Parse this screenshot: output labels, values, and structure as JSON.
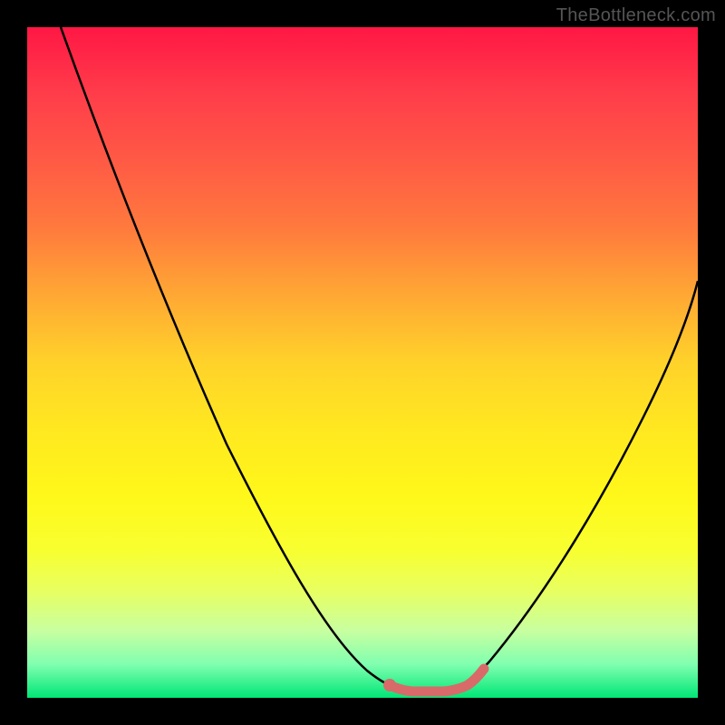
{
  "watermark": "TheBottleneck.com",
  "chart_data": {
    "type": "line",
    "title": "",
    "xlabel": "",
    "ylabel": "",
    "xlim": [
      0,
      100
    ],
    "ylim": [
      0,
      100
    ],
    "series": [
      {
        "name": "bottleneck-curve",
        "x": [
          5,
          10,
          15,
          20,
          25,
          30,
          35,
          40,
          45,
          50,
          52,
          55,
          58,
          60,
          62,
          65,
          70,
          75,
          80,
          85,
          90,
          95,
          100
        ],
        "y": [
          100,
          90,
          80,
          70,
          60,
          50,
          40,
          30,
          20,
          10,
          5,
          2,
          1,
          1,
          2,
          5,
          12,
          20,
          30,
          40,
          50,
          58,
          65
        ],
        "color": "#000000"
      },
      {
        "name": "valley-highlight",
        "x": [
          50,
          52,
          55,
          58,
          60,
          62,
          65
        ],
        "y": [
          5,
          2,
          1,
          1,
          1,
          2,
          5
        ],
        "color": "#d96a6a"
      }
    ],
    "gradient_stops": [
      {
        "pos": 0,
        "color": "#ff1744"
      },
      {
        "pos": 50,
        "color": "#ffd22a"
      },
      {
        "pos": 80,
        "color": "#f8ff30"
      },
      {
        "pos": 100,
        "color": "#00e676"
      }
    ]
  }
}
